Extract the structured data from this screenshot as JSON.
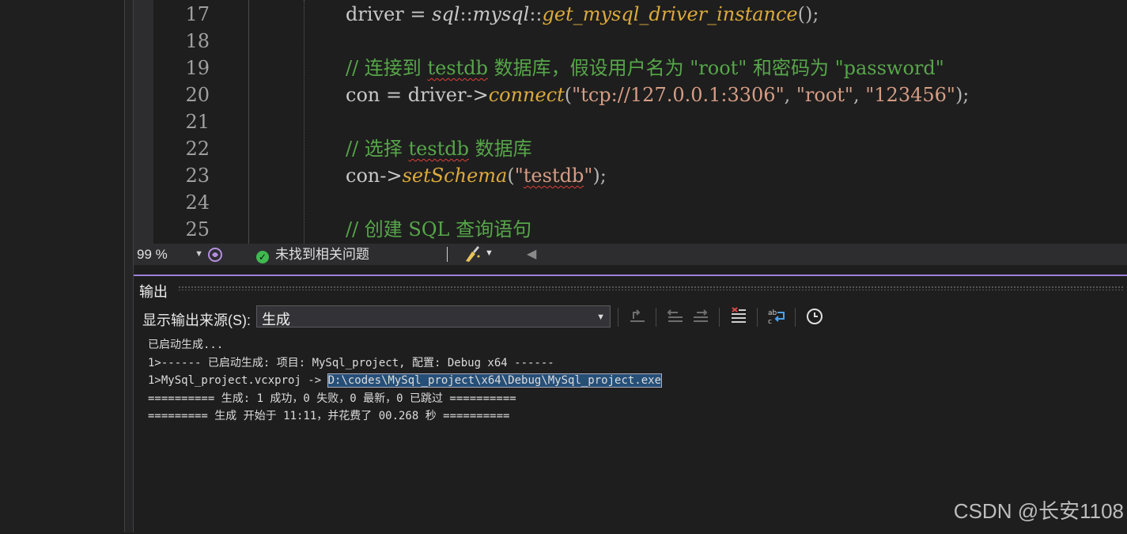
{
  "editor": {
    "lines": [
      {
        "num": "17",
        "tokens": [
          {
            "t": "driver = ",
            "c": "tok-id"
          },
          {
            "t": "sql",
            "c": "tok-ns"
          },
          {
            "t": "::",
            "c": "tok-op"
          },
          {
            "t": "mysql",
            "c": "tok-ns"
          },
          {
            "t": "::",
            "c": "tok-op"
          },
          {
            "t": "get_mysql_driver_instance",
            "c": "tok-fn"
          },
          {
            "t": "();",
            "c": "tok-op"
          }
        ]
      },
      {
        "num": "18",
        "tokens": []
      },
      {
        "num": "19",
        "tokens": [
          {
            "t": "// 连接到 ",
            "c": "tok-cm"
          },
          {
            "t": "testdb",
            "c": "tok-cm squiggle"
          },
          {
            "t": " 数据库，假设用户名为 \"root\" 和密码为 \"password\"",
            "c": "tok-cm"
          }
        ]
      },
      {
        "num": "20",
        "tokens": [
          {
            "t": "con = driver->",
            "c": "tok-id"
          },
          {
            "t": "connect",
            "c": "tok-fn"
          },
          {
            "t": "(",
            "c": "tok-op"
          },
          {
            "t": "\"tcp://127.0.0.1:3306\"",
            "c": "tok-str"
          },
          {
            "t": ", ",
            "c": "tok-op"
          },
          {
            "t": "\"root\"",
            "c": "tok-str"
          },
          {
            "t": ", ",
            "c": "tok-op"
          },
          {
            "t": "\"123456\"",
            "c": "tok-str"
          },
          {
            "t": ");",
            "c": "tok-op"
          }
        ]
      },
      {
        "num": "21",
        "tokens": []
      },
      {
        "num": "22",
        "tokens": [
          {
            "t": "// 选择 ",
            "c": "tok-cm"
          },
          {
            "t": "testdb",
            "c": "tok-cm squiggle"
          },
          {
            "t": " 数据库",
            "c": "tok-cm"
          }
        ]
      },
      {
        "num": "23",
        "tokens": [
          {
            "t": "con->",
            "c": "tok-id"
          },
          {
            "t": "setSchema",
            "c": "tok-fn"
          },
          {
            "t": "(",
            "c": "tok-op"
          },
          {
            "t": "\"",
            "c": "tok-str"
          },
          {
            "t": "testdb",
            "c": "tok-str squiggle"
          },
          {
            "t": "\"",
            "c": "tok-str"
          },
          {
            "t": ");",
            "c": "tok-op"
          }
        ]
      },
      {
        "num": "24",
        "tokens": []
      },
      {
        "num": "25",
        "tokens": [
          {
            "t": "// 创建 SQL 查询语句",
            "c": "tok-cm"
          }
        ]
      }
    ]
  },
  "status_bar": {
    "zoom": "99 %",
    "issues": "未找到相关问题"
  },
  "output": {
    "title": "输出",
    "source_label": "显示输出来源(S):",
    "source_value": "生成",
    "lines": [
      {
        "text": "已启动生成..."
      },
      {
        "text": "1>------ 已启动生成: 项目: MySql_project, 配置: Debug x64 ------"
      },
      {
        "text": "1>MySql_project.vcxproj -> ",
        "selected": "D:\\codes\\MySql_project\\x64\\Debug\\MySql_project.exe"
      },
      {
        "text": "========== 生成: 1 成功，0 失败，0 最新，0 已跳过 =========="
      },
      {
        "text": "========= 生成 开始于 11:11，并花费了 00.268 秒 =========="
      }
    ]
  },
  "watermark": "CSDN @长安1108",
  "colors": {
    "accent": "#9b80d9",
    "comment": "#57a64a",
    "function": "#dcaa3c",
    "string": "#d69d85",
    "selection": "#264f78"
  }
}
